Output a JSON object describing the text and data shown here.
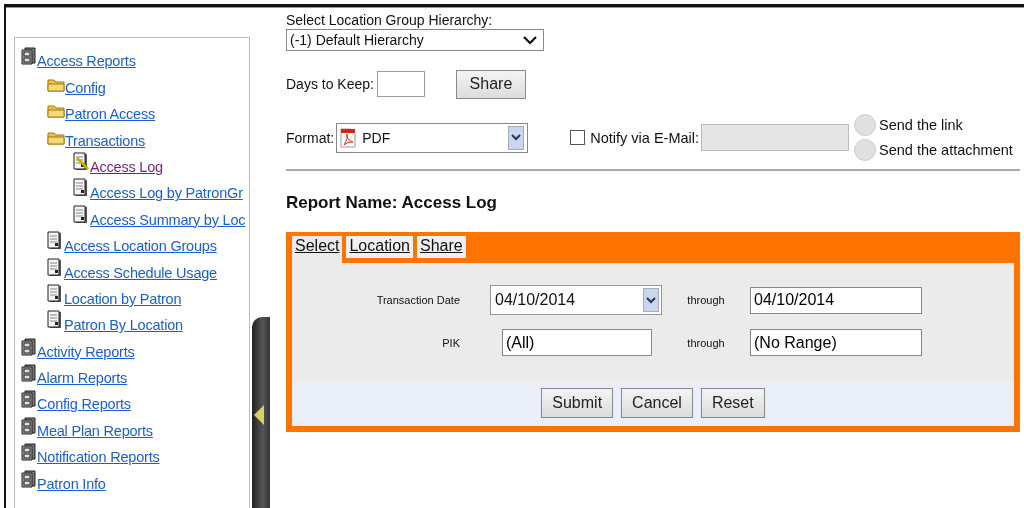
{
  "sidebar": {
    "tree": [
      {
        "label": "Access Reports",
        "kind": "cabinet",
        "selected": false,
        "children": [
          {
            "label": "Config",
            "kind": "folder",
            "selected": false
          },
          {
            "label": "Patron Access",
            "kind": "folder",
            "selected": false
          },
          {
            "label": "Transactions",
            "kind": "folder",
            "selected": false,
            "children": [
              {
                "label": "Access Log",
                "kind": "report-edit",
                "selected": true
              },
              {
                "label": "Access Log by PatronGr",
                "kind": "report",
                "selected": false
              },
              {
                "label": "Access Summary by Loc",
                "kind": "report",
                "selected": false
              }
            ]
          },
          {
            "label": "Access Location Groups",
            "kind": "report",
            "selected": false
          },
          {
            "label": "Access Schedule Usage",
            "kind": "report",
            "selected": false
          },
          {
            "label": "Location by Patron",
            "kind": "report",
            "selected": false
          },
          {
            "label": "Patron By Location",
            "kind": "report",
            "selected": false
          }
        ]
      },
      {
        "label": "Activity Reports",
        "kind": "cabinet",
        "selected": false
      },
      {
        "label": "Alarm Reports",
        "kind": "cabinet",
        "selected": false
      },
      {
        "label": "Config Reports",
        "kind": "cabinet",
        "selected": false
      },
      {
        "label": "Meal Plan Reports",
        "kind": "cabinet",
        "selected": false
      },
      {
        "label": "Notification Reports",
        "kind": "cabinet",
        "selected": false
      },
      {
        "label": "Patron Info",
        "kind": "cabinet",
        "selected": false
      }
    ]
  },
  "hierarchy": {
    "label": "Select Location Group Hierarchy:",
    "value": "(-1) Default Hierarchy"
  },
  "days_to_keep": {
    "label": "Days to Keep:"
  },
  "share_button": "Share",
  "format": {
    "label": "Format:",
    "value": "PDF"
  },
  "notify": {
    "label": "Notify via E-Mail:",
    "checked": false
  },
  "delivery_options": [
    {
      "label": "Send the link",
      "selected": false
    },
    {
      "label": "Send the attachment",
      "selected": false
    }
  ],
  "report_name": "Report Name: Access Log",
  "tabs": [
    {
      "label": "Select",
      "selected": true
    },
    {
      "label": "Location",
      "selected": false
    },
    {
      "label": "Share",
      "selected": false
    }
  ],
  "criteria": [
    {
      "label": "Transaction Date",
      "kind": "date",
      "from": "04/10/2014",
      "through_label": "through",
      "to": "04/10/2014"
    },
    {
      "label": "PIK",
      "kind": "text",
      "from": "(All)",
      "through_label": "through",
      "to": "(No Range)"
    }
  ],
  "buttons": [
    "Submit",
    "Cancel",
    "Reset"
  ]
}
